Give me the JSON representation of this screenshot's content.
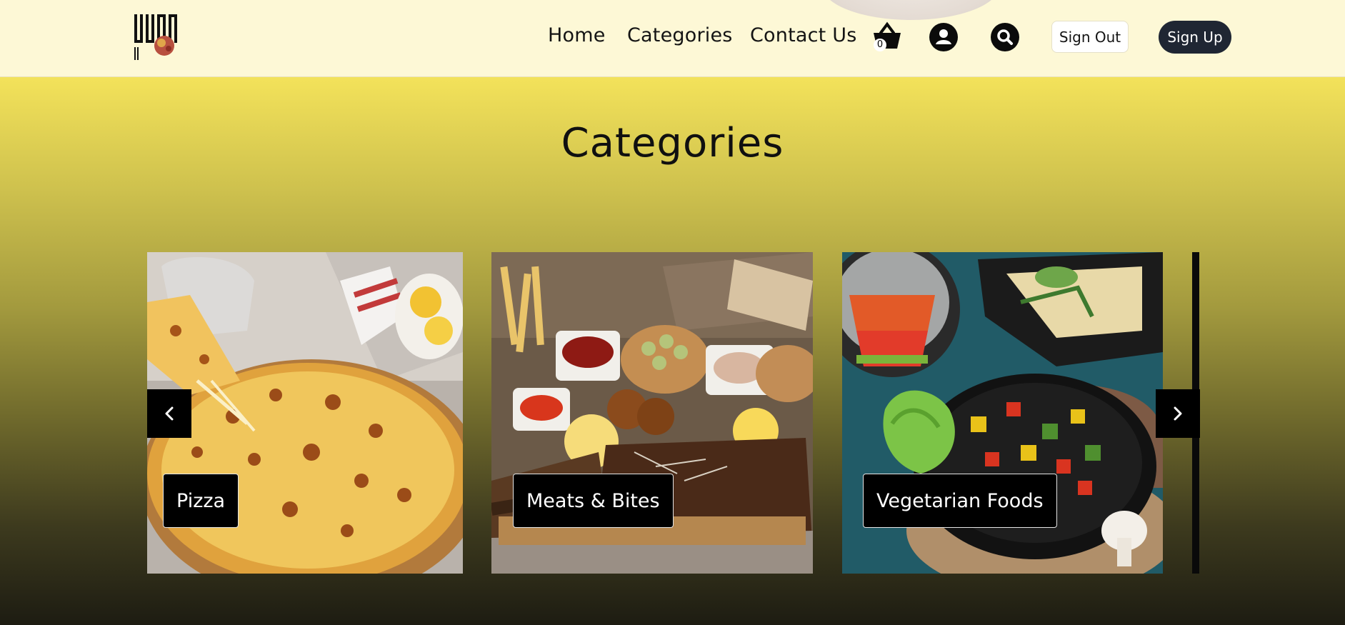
{
  "header": {
    "logo": {
      "name": "yummy-yard-logo",
      "text": "YUMMY YARD"
    },
    "nav": [
      {
        "label": "Home"
      },
      {
        "label": "Categories"
      },
      {
        "label": "Contact Us"
      }
    ],
    "cart_count": "0",
    "icons": [
      "basket-icon",
      "user-icon",
      "search-icon"
    ],
    "sign_out_label": "Sign Out",
    "sign_up_label": "Sign Up"
  },
  "main": {
    "title": "Categories",
    "categories": [
      {
        "label": "Pizza",
        "image": "pizza-image"
      },
      {
        "label": "Meats & Bites",
        "image": "meats-bites-image"
      },
      {
        "label": "Vegetarian Foods",
        "image": "vegetarian-foods-image"
      }
    ],
    "prev_icon": "chevron-left-icon",
    "next_icon": "chevron-right-icon"
  },
  "colors": {
    "header_bg": "#fdf8d6",
    "gradient_top": "#f3e25a",
    "gradient_bottom": "#1d1c12",
    "signup_bg": "#1f2633",
    "label_bg": "#000000"
  }
}
